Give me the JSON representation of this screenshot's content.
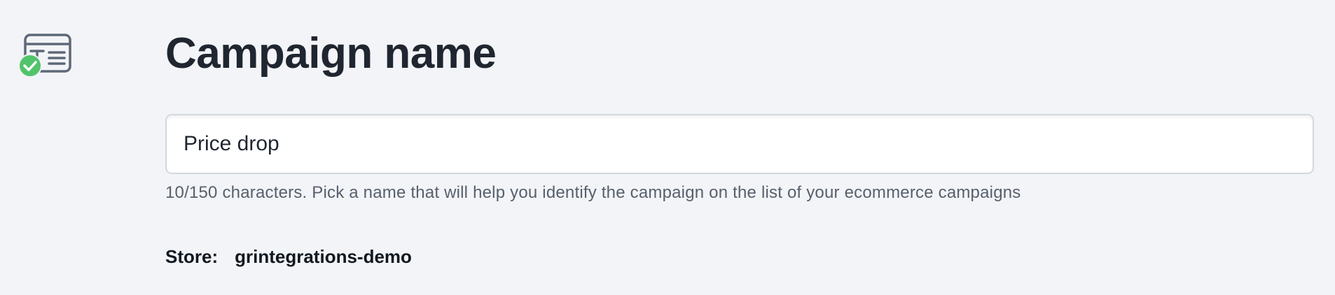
{
  "step": {
    "icon": "text-field-icon",
    "status_icon": "check-circle-icon",
    "status_color": "#52c46b"
  },
  "title": "Campaign name",
  "name_field": {
    "value": "Price drop",
    "helper": "10/150 characters. Pick a name that will help you identify the campaign on the list of your ecommerce campaigns"
  },
  "store": {
    "label": "Store:",
    "value": "grintegrations-demo"
  }
}
